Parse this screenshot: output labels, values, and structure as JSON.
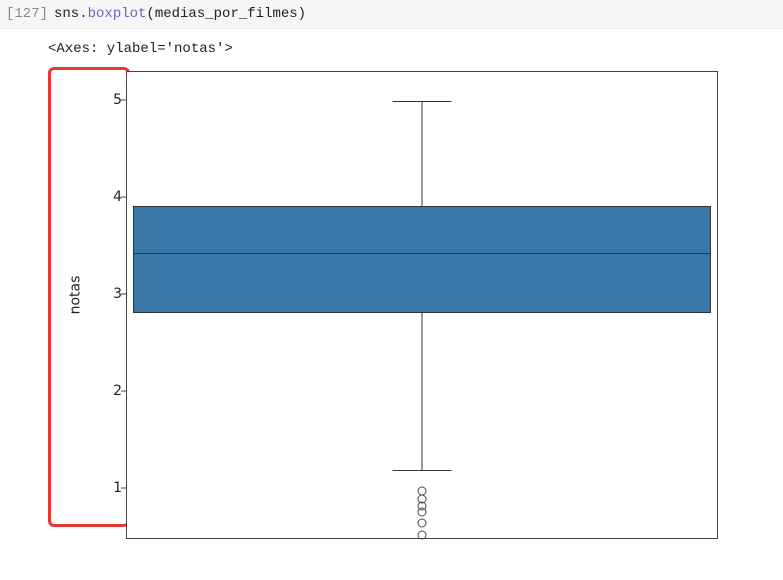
{
  "cell": {
    "execution_label": "[127]",
    "code": {
      "prefix": "sns.",
      "func": "boxplot",
      "open": "(",
      "arg": "medias_por_filmes",
      "close": ")"
    }
  },
  "output_text": "<Axes: ylabel='notas'>",
  "chart_data": {
    "type": "boxplot",
    "ylabel": "notas",
    "ylim": [
      0.5,
      5.3
    ],
    "yticks": [
      1,
      2,
      3,
      4,
      5
    ],
    "box": {
      "q1": 2.82,
      "median": 3.44,
      "q3": 3.92,
      "whisker_low": 1.2,
      "whisker_high": 5.0,
      "cap_width_frac": 0.1,
      "box_width_frac": 0.98
    },
    "outliers": [
      0.98,
      0.9,
      0.83,
      0.77,
      0.65,
      0.53
    ],
    "colors": {
      "box_fill": "#3a77a6",
      "line": "#333333"
    }
  },
  "annotation": {
    "type": "red-rectangle",
    "target": "y-axis-region"
  }
}
